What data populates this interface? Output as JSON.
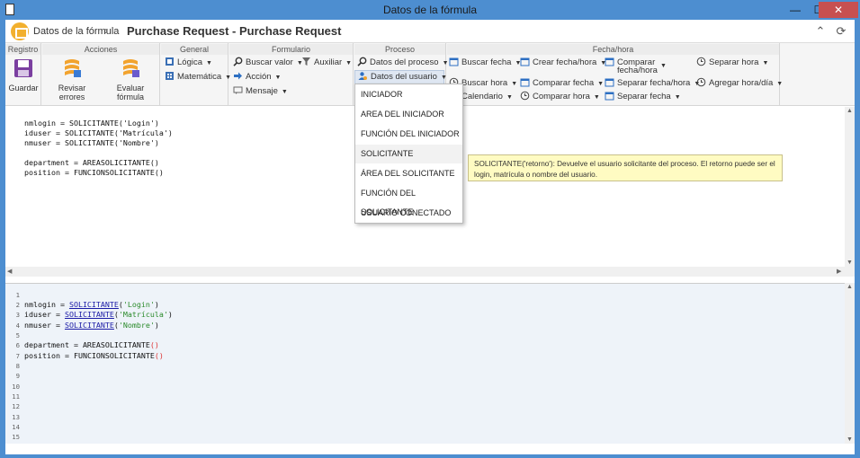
{
  "window": {
    "title": "Datos de la fórmula",
    "minimize": "—",
    "maximize": "☐",
    "close": "✕"
  },
  "header": {
    "breadcrumb_root": "Datos de la fórmula",
    "breadcrumb_sep": "›",
    "page_title": "Purchase Request - Purchase Request",
    "collapse_icon": "⌃",
    "refresh_icon": "⟳"
  },
  "ribbon": {
    "registro": {
      "title": "Registro",
      "save": "Guardar"
    },
    "acciones": {
      "title": "Acciones",
      "review": "Revisar errores",
      "evaluate": "Evaluar fórmula"
    },
    "general": {
      "title": "General",
      "logic": "Lógica",
      "math": "Matemática"
    },
    "formulario": {
      "title": "Formulario",
      "search_value": "Buscar valor",
      "auxiliar": "Auxiliar",
      "action": "Acción",
      "message": "Mensaje"
    },
    "proceso": {
      "title": "Proceso",
      "process_data": "Datos del proceso",
      "user_data": "Datos del usuario"
    },
    "fechahora": {
      "title": "Fecha/hora",
      "search_date": "Buscar fecha",
      "create_datetime": "Crear fecha/hora",
      "compare_datetime_1": "Comparar",
      "compare_datetime_2": "fecha/hora",
      "separate_hour": "Separar hora",
      "search_hour": "Buscar hora",
      "compare_date": "Comparar fecha",
      "separate_datetime": "Separar fecha/hora",
      "add_hourday": "Agregar hora/día",
      "calendar": "Calendario",
      "compare_hour": "Comparar hora",
      "separate_date": "Separar fecha"
    }
  },
  "editor_top": {
    "lines": [
      "nmlogin = SOLICITANTE('Login')",
      "iduser = SOLICITANTE('Matrícula')",
      "nmuser = SOLICITANTE('Nombre')",
      "",
      "department = AREASOLICITANTE()",
      "position = FUNCIONSOLICITANTE()"
    ]
  },
  "editor_bottom": {
    "line_numbers": [
      "1",
      "2",
      "3",
      "4",
      "5",
      "6",
      "7",
      "8",
      "9",
      "10",
      "11",
      "12",
      "13",
      "14",
      "15"
    ],
    "l2_var": "nmlogin = ",
    "l2_fn": "SOLICITANTE",
    "l2_open": "(",
    "l2_str": "'Login'",
    "l2_close": ")",
    "l3_var": "iduser = ",
    "l3_fn": "SOLICITANTE",
    "l3_open": "(",
    "l3_str": "'Matrícula'",
    "l3_close": ")",
    "l4_var": "nmuser = ",
    "l4_fn": "SOLICITANTE",
    "l4_open": "(",
    "l4_str": "'Nombre'",
    "l4_close": ")",
    "l6_var": "department = ",
    "l6_fn": "AREASOLICITANTE",
    "l6_paren": "()",
    "l7_var": "position = ",
    "l7_fn": "FUNCIONSOLICITANTE",
    "l7_paren": "()"
  },
  "dropdown": {
    "items": [
      "INICIADOR",
      "AREA DEL INICIADOR",
      "FUNCIÓN DEL INICIADOR",
      "SOLICITANTE",
      "ÁREA DEL SOLICITANTE",
      "FUNCIÓN DEL SOLICITANTE",
      "USUARIO CONECTADO"
    ]
  },
  "tooltip": {
    "text": "SOLICITANTE('retorno'): Devuelve el usuario solicitante del proceso. El retorno puede ser el login, matrícula o nombre del usuario."
  },
  "colors": {
    "accent": "#4d8ed0",
    "logo": "#f2b02e",
    "close": "#c75050",
    "tooltip_bg": "#fffbc2"
  }
}
